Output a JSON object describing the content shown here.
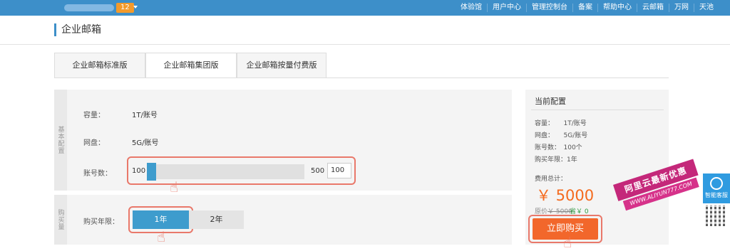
{
  "topbar": {
    "badge": "12",
    "nav": [
      "体验馆",
      "用户中心",
      "管理控制台",
      "备案",
      "帮助中心",
      "云邮箱",
      "万网",
      "天池"
    ]
  },
  "page": {
    "title": "企业邮箱"
  },
  "tabs": [
    "企业邮箱标准版",
    "企业邮箱集团版",
    "企业邮箱按量付费版"
  ],
  "basic_config": {
    "section_label": "基本配置",
    "capacity_label": "容量：",
    "capacity_value": "1T/账号",
    "disk_label": "网盘：",
    "disk_value": "5G/账号",
    "accounts_label": "账号数：",
    "slider_min": "100",
    "slider_max": "500",
    "accounts_input": "100"
  },
  "purchase": {
    "section_label": "购买量",
    "years_label": "购买年限：",
    "options": [
      "1年",
      "2年"
    ],
    "selected": "1年"
  },
  "sidebar": {
    "title": "当前配置",
    "lines": [
      "容量：　　1T/账号",
      "网盘：　　5G/账号",
      "账号数：　100个",
      "购买年限：1年"
    ],
    "total_label": "费用总计：",
    "price": "￥ 5000",
    "original_prefix": "原价",
    "original_price": "￥ 5000",
    "save_text": "省￥ 0",
    "buy_button": "立即购买"
  },
  "promo": {
    "main": "阿里云最新优惠",
    "sub": "WWW.ALIYUN777.COM"
  },
  "widget": {
    "kefu": "智能客服"
  },
  "colors": {
    "topbar": "#3d8fc9",
    "accent_blue": "#3e9ccd",
    "price_orange": "#f46a1e",
    "buy_button": "#f2672b",
    "highlight_red": "#e9786a"
  }
}
